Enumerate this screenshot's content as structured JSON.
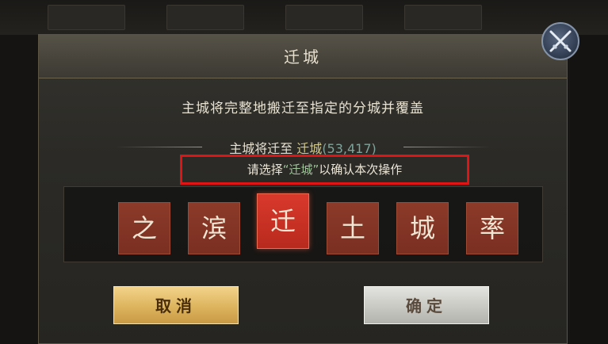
{
  "dialog": {
    "title": "迁城",
    "description": "主城将完整地搬迁至指定的分城并覆盖",
    "target": {
      "prefix": "主城将迁至 ",
      "city": "迁城",
      "coords": "(53,417)"
    },
    "instruction": {
      "before": "请选择",
      "keyword": "“迁城”",
      "after": "以确认本次操作"
    },
    "characters": [
      {
        "label": "之",
        "selected": false
      },
      {
        "label": "滨",
        "selected": false
      },
      {
        "label": "迁",
        "selected": true
      },
      {
        "label": "土",
        "selected": false
      },
      {
        "label": "城",
        "selected": false
      },
      {
        "label": "率",
        "selected": false
      }
    ],
    "cancel_label": "取消",
    "confirm_label": "确定"
  },
  "close_icon": "crossed-swords-icon",
  "colors": {
    "tile": "#7a2f21",
    "tile_selected": "#d9392b",
    "highlight_box": "#e01414",
    "keyword": "#9fc79a"
  }
}
